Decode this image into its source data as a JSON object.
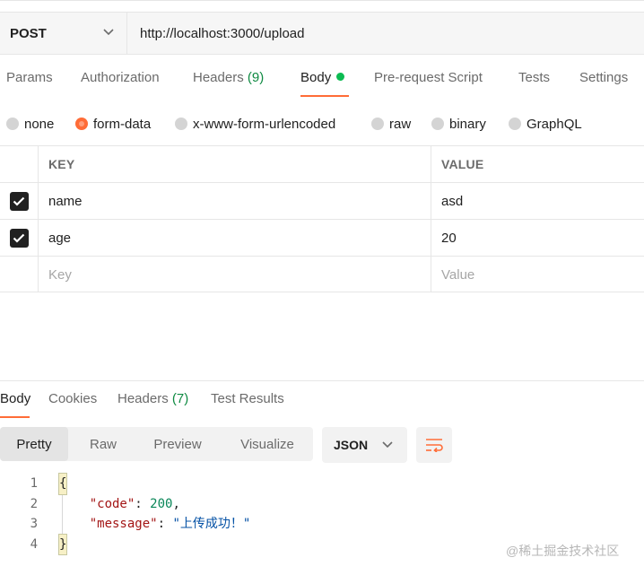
{
  "request": {
    "method": "POST",
    "url": "http://localhost:3000/upload",
    "tabs": [
      {
        "label": "Params"
      },
      {
        "label": "Authorization"
      },
      {
        "label": "Headers",
        "count": "(9)"
      },
      {
        "label": "Body"
      },
      {
        "label": "Pre-request Script"
      },
      {
        "label": "Tests"
      },
      {
        "label": "Settings"
      }
    ],
    "active_tab": "Body",
    "body_types": [
      {
        "label": "none"
      },
      {
        "label": "form-data"
      },
      {
        "label": "x-www-form-urlencoded"
      },
      {
        "label": "raw"
      },
      {
        "label": "binary"
      },
      {
        "label": "GraphQL"
      }
    ],
    "selected_body_type": "form-data",
    "table": {
      "key_header": "KEY",
      "value_header": "VALUE",
      "rows": [
        {
          "key": "name",
          "value": "asd",
          "checked": true
        },
        {
          "key": "age",
          "value": "20",
          "checked": true
        }
      ],
      "key_placeholder": "Key",
      "value_placeholder": "Value"
    }
  },
  "response": {
    "tabs": [
      {
        "label": "Body"
      },
      {
        "label": "Cookies"
      },
      {
        "label": "Headers",
        "count": "(7)"
      },
      {
        "label": "Test Results"
      }
    ],
    "active_tab": "Body",
    "views": [
      "Pretty",
      "Raw",
      "Preview",
      "Visualize"
    ],
    "active_view": "Pretty",
    "format": "JSON",
    "code": {
      "line_numbers": [
        "1",
        "2",
        "3",
        "4"
      ],
      "open_brace": "{",
      "close_brace": "}",
      "code_key": "\"code\"",
      "code_value": "200",
      "message_key": "\"message\"",
      "message_value": "\"上传成功！\""
    }
  },
  "watermark": "@稀土掘金技术社区",
  "colors": {
    "accent": "#ff6c37",
    "success_dot": "#0cbb52",
    "count_green": "#0f8a42"
  },
  "icons": [
    "chevron-down-icon",
    "check-icon",
    "wrap-lines-icon"
  ]
}
